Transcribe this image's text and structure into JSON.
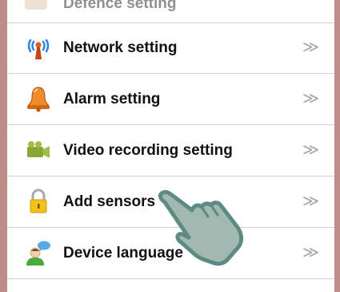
{
  "menu": {
    "partial_top_label": "Defence setting",
    "items": [
      {
        "label": "Network setting",
        "icon": "antenna-icon",
        "chevron": "≫"
      },
      {
        "label": "Alarm setting",
        "icon": "bell-icon",
        "chevron": "≫"
      },
      {
        "label": "Video recording setting",
        "icon": "camera-icon",
        "chevron": "≫"
      },
      {
        "label": "Add sensors",
        "icon": "lock-icon",
        "chevron": "≫"
      },
      {
        "label": "Device language",
        "icon": "user-chat-icon",
        "chevron": "≫"
      }
    ]
  },
  "colors": {
    "frame": "#c08c88",
    "hand": "#a3b8b0",
    "hand_outline": "#5e8a84"
  }
}
